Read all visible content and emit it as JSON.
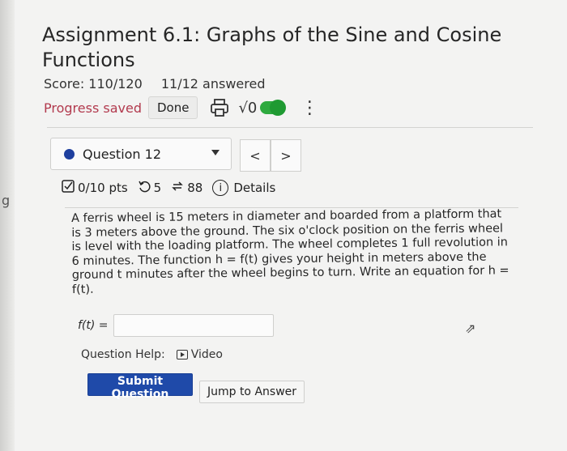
{
  "assignment": {
    "title": "Assignment 6.1: Graphs of the Sine and Cosine Functions",
    "score": "Score: 110/120",
    "answered": "11/12 answered",
    "progress_saved": "Progress saved",
    "done_label": "Done",
    "sqrt_label": "√0"
  },
  "left_edge_char": "g",
  "question": {
    "selector_label": "Question 12",
    "prev_label": "<",
    "next_label": ">",
    "points": "0/10 pts",
    "retries": "5",
    "attempts": "88",
    "details_label": "Details",
    "text": "A ferris wheel is 15 meters in diameter and boarded from a platform that is 3 meters above the ground. The six o'clock position on the ferris wheel is level with the loading platform. The wheel completes 1 full revolution in 6 minutes. The function h = f(t) gives your height in meters above the ground t minutes after the wheel begins to turn. Write an equation for h = f(t).",
    "answer_label": "f(t) =",
    "answer_value": "",
    "help_label": "Question Help:",
    "video_label": "Video",
    "submit_label": "Submit Question",
    "jump_label": "Jump to Answer"
  },
  "colors": {
    "accent": "#1f4aa9",
    "saved": "#b23a4e",
    "toggle": "#2eaa3f"
  },
  "icons": [
    "print-icon",
    "sqrt-icon",
    "toggle-switch",
    "kebab-menu-icon",
    "checkbox-icon",
    "retry-icon",
    "attempts-icon",
    "info-icon",
    "video-icon",
    "mouse-cursor-icon"
  ]
}
